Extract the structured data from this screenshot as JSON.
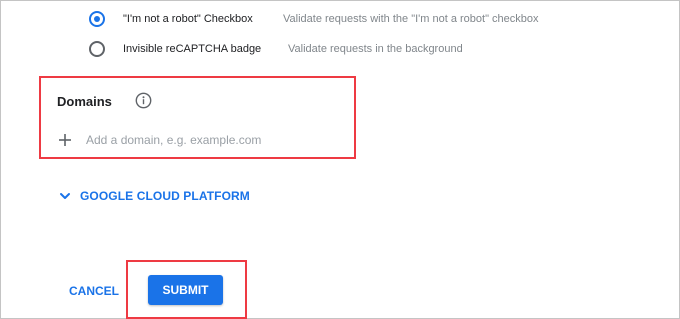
{
  "recaptcha_type": {
    "options": [
      {
        "label": "\"I'm not a robot\" Checkbox",
        "description": "Validate requests with the \"I'm not a robot\" checkbox",
        "selected": true
      },
      {
        "label": "Invisible reCAPTCHA badge",
        "description": "Validate requests in the background",
        "selected": false
      }
    ]
  },
  "domains": {
    "title": "Domains",
    "info_icon": "info-icon",
    "add_icon": "plus-icon",
    "placeholder": "Add a domain, e.g. example.com",
    "value": ""
  },
  "gcp": {
    "label": "GOOGLE CLOUD PLATFORM",
    "icon": "chevron-down-icon"
  },
  "actions": {
    "cancel_label": "CANCEL",
    "submit_label": "SUBMIT"
  },
  "colors": {
    "accent": "#1a73e8",
    "highlight": "#ee3a43"
  }
}
